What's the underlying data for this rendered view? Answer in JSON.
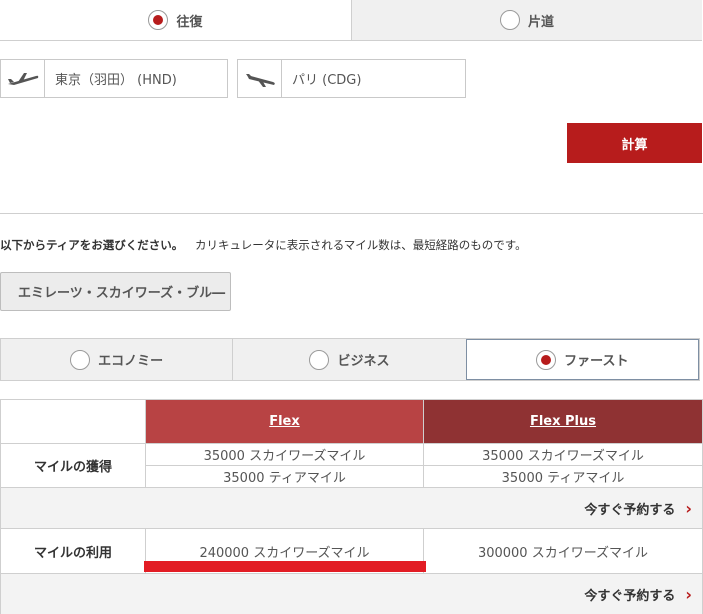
{
  "trip_type": {
    "round_trip": "往復",
    "one_way": "片道"
  },
  "airports": {
    "origin": "東京（羽田） (HND)",
    "destination": "パリ (CDG)"
  },
  "calculate_label": "計算",
  "tier": {
    "instruction_bold": "以下からティアをお選びください。",
    "instruction_note": "カリキュレータに表示されるマイル数は、最短経路のものです。",
    "selected": "エミレーツ・スカイワーズ・ブル―"
  },
  "cabins": {
    "economy": "エコノミー",
    "business": "ビジネス",
    "first": "ファースト"
  },
  "fare_table": {
    "headers": [
      "Flex",
      "Flex Plus"
    ],
    "earn_label": "マイルの獲得",
    "earn": {
      "flex_skywards": "35000 スカイワーズマイル",
      "flex_tier": "35000 ティアマイル",
      "flexplus_skywards": "35000 スカイワーズマイル",
      "flexplus_tier": "35000 ティアマイル"
    },
    "book_now": "今すぐ予約する",
    "use_label": "マイルの利用",
    "use": {
      "flex": "240000 スカイワーズマイル",
      "flexplus": "300000 スカイワーズマイル"
    }
  },
  "colors": {
    "accent": "#b71c1c",
    "header_flex": "#b84344",
    "header_flexplus": "#8f3233",
    "highlight": "#e21c24"
  }
}
